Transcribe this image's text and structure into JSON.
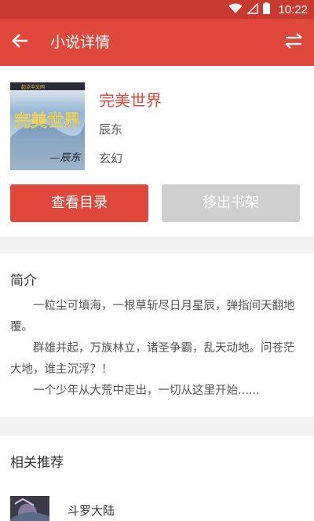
{
  "status_bar": {
    "time": "10:22"
  },
  "header": {
    "title": "小说详情"
  },
  "book": {
    "title": "完美世界",
    "author": "辰东",
    "genre": "玄幻",
    "cover": {
      "title_art": "完美世界",
      "author_art": "—辰东",
      "publisher_art": "起点中文网"
    }
  },
  "actions": {
    "view_catalog": "查看目录",
    "remove_from_shelf": "移出书架"
  },
  "intro": {
    "heading": "简介",
    "paragraphs": [
      "一粒尘可填海，一根草斩尽日月星辰，弹指间天翻地覆。",
      "群雄并起，万族林立，诸圣争霸，乱天动地。问苍茫大地，谁主沉浮？！",
      "一个少年从大荒中走出，一切从这里开始......"
    ]
  },
  "recommendations": {
    "heading": "相关推荐",
    "items": [
      {
        "title": "斗罗大陆"
      }
    ]
  },
  "colors": {
    "primary": "#e0483b",
    "status_bar": "#c8392f",
    "disabled_button": "#cfcfcf",
    "background": "#f2f2f2"
  }
}
